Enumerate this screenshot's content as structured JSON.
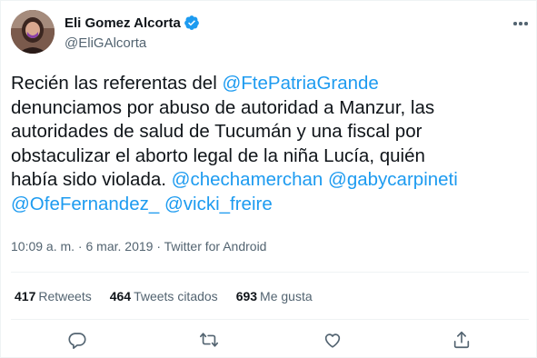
{
  "author": {
    "display_name": "Eli Gomez Alcorta",
    "handle": "@EliGAlcorta",
    "avatar_icon": "profile-photo",
    "verified_icon": "verified-badge-icon"
  },
  "tweet": {
    "lines": [
      [
        {
          "t": "Recién las referentas del ",
          "m": false
        },
        {
          "t": "@FtePatriaGrande",
          "m": true
        }
      ],
      [
        {
          "t": "denunciamos por abuso de autoridad a Manzur, las",
          "m": false
        }
      ],
      [
        {
          "t": "autoridades de salud de Tucumán y una fiscal por",
          "m": false
        }
      ],
      [
        {
          "t": "obstaculizar el aborto legal de la niña Lucía, quién",
          "m": false
        }
      ],
      [
        {
          "t": "había sido violada. ",
          "m": false
        },
        {
          "t": "@chechamerchan",
          "m": true
        },
        {
          "t": " ",
          "m": false
        },
        {
          "t": "@gabycarpineti",
          "m": true
        }
      ],
      [
        {
          "t": "@OfeFernandez_",
          "m": true
        },
        {
          "t": " ",
          "m": false
        },
        {
          "t": "@vicki_freire",
          "m": true
        }
      ]
    ],
    "time": "10:09 a. m.",
    "date": "6 mar. 2019",
    "source": "Twitter for Android",
    "separator": " · "
  },
  "stats": {
    "retweets_count": "417",
    "retweets_label": "Retweets",
    "quotes_count": "464",
    "quotes_label": "Tweets citados",
    "likes_count": "693",
    "likes_label": "Me gusta"
  },
  "colors": {
    "mention": "#1d9bf0",
    "secondary_text": "#536471",
    "primary_text": "#0f1419",
    "divider": "#eff3f4"
  },
  "actions": [
    {
      "name": "reply-icon"
    },
    {
      "name": "retweet-icon"
    },
    {
      "name": "like-icon"
    },
    {
      "name": "share-icon"
    }
  ]
}
